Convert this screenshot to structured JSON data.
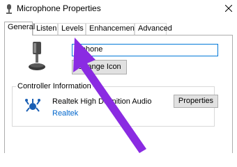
{
  "window": {
    "title": "Microphone Properties"
  },
  "tabs": [
    {
      "label": "General",
      "active": true
    },
    {
      "label": "Listen",
      "active": false
    },
    {
      "label": "Levels",
      "active": false
    },
    {
      "label": "Enhancements",
      "active": false
    },
    {
      "label": "Advanced",
      "active": false
    }
  ],
  "general": {
    "name_value": "Microphone",
    "visible_name_text": "rophone",
    "change_icon_label": "Change Icon",
    "controller_group_label": "Controller Information",
    "controller_name": "Realtek High Definition Audio",
    "controller_vendor": "Realtek",
    "properties_label": "Properties"
  },
  "colors": {
    "annotation_arrow": "#8a2be2",
    "link": "#0066cc",
    "focus_border": "#0078d7"
  },
  "icons": {
    "title": "microphone-icon",
    "close": "close-icon",
    "device": "microphone-icon",
    "controller": "realtek-crab-icon"
  }
}
